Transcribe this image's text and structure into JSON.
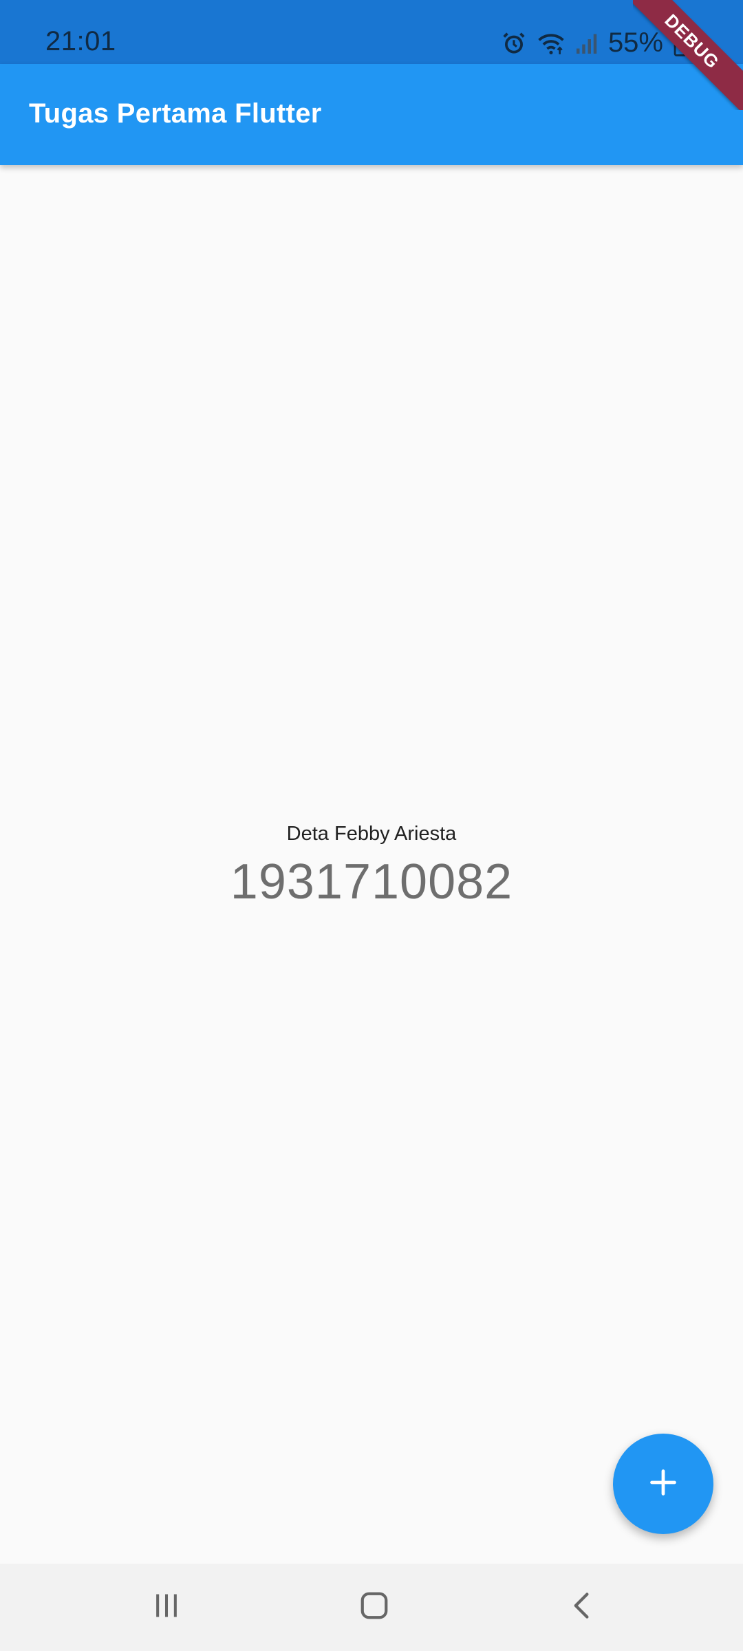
{
  "status_bar": {
    "time": "21:01",
    "battery": "55%",
    "icons": [
      "alarm-icon",
      "wifi-icon",
      "signal-icon",
      "battery-icon"
    ]
  },
  "app_bar": {
    "title": "Tugas Pertama Flutter"
  },
  "debug_banner": {
    "label": "DEBUG"
  },
  "main": {
    "name": "Deta Febby Ariesta",
    "counter": "1931710082"
  },
  "fab": {
    "icon": "plus-icon"
  },
  "nav_bar": {
    "buttons": [
      "recent-apps-icon",
      "home-icon",
      "back-icon"
    ]
  },
  "colors": {
    "primary": "#2196f3",
    "primary_dark": "#1976d2",
    "background": "#fafafa",
    "debug": "#8e2b45"
  }
}
